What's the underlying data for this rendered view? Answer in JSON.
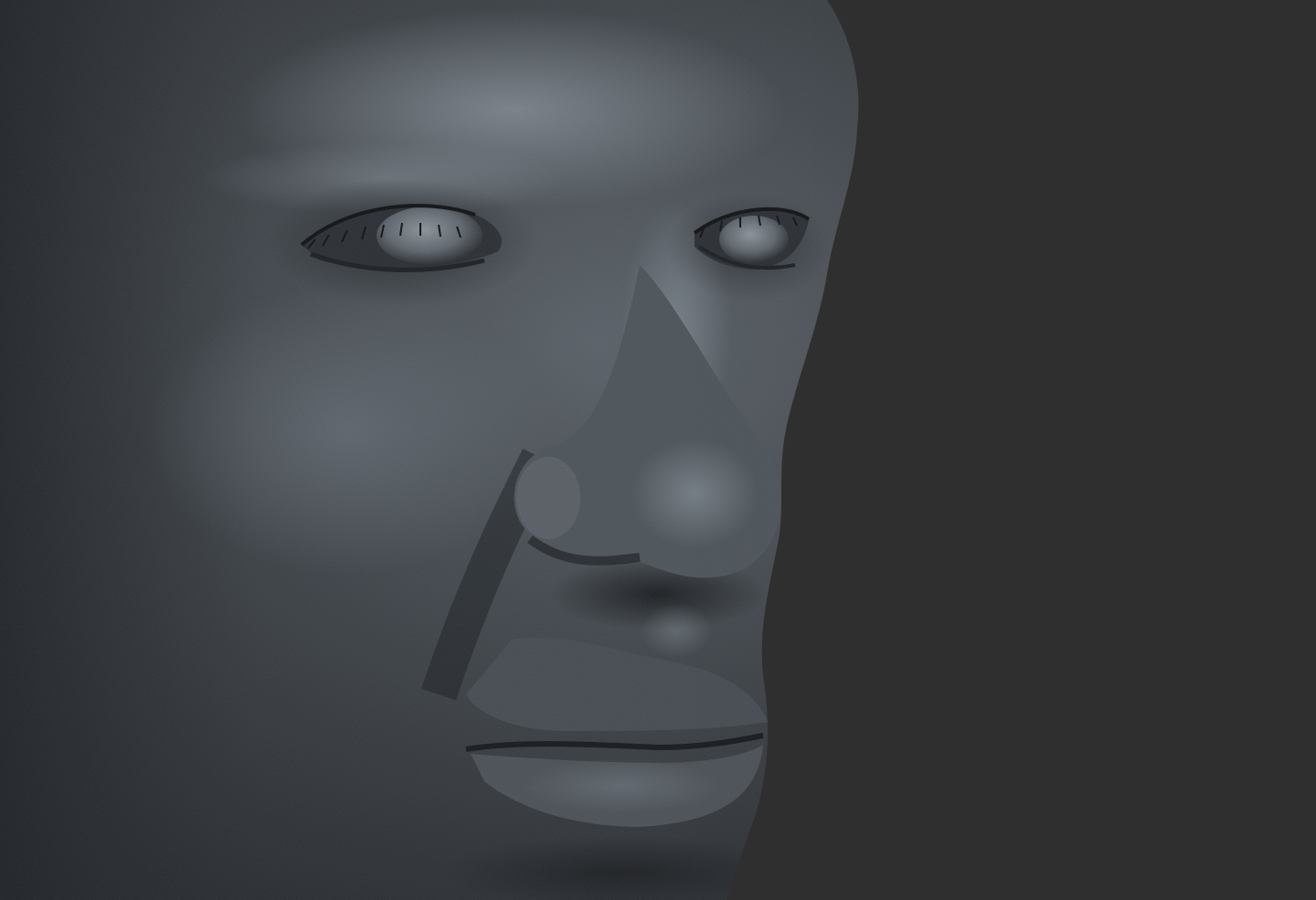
{
  "scene": {
    "subject": "sculpted-head-closeup",
    "material": "grey-clay",
    "colors": {
      "background": "#2f2f2f",
      "skin_shadow": "#1e2125",
      "skin_mid": "#3d4247",
      "skin_light": "#5f666d",
      "skin_highlight": "#8a939b",
      "eyelash": "#101214"
    }
  }
}
